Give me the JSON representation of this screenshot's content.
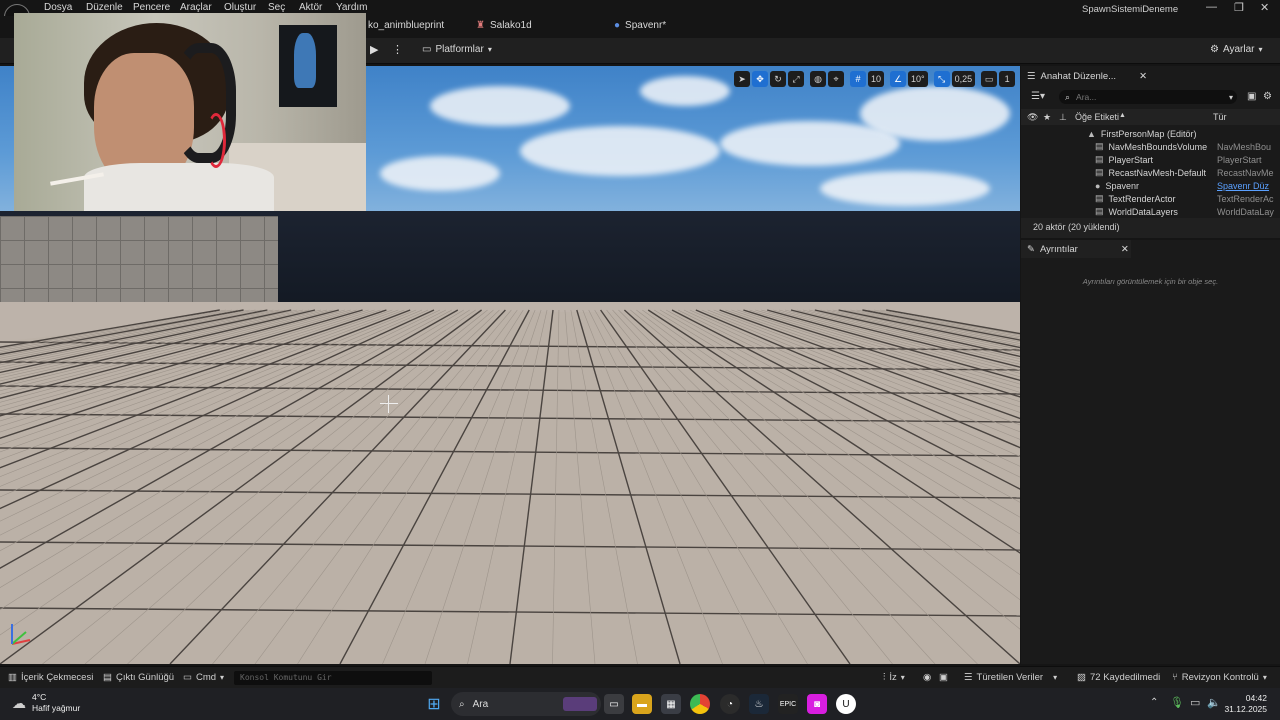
{
  "menu": {
    "items": [
      "Dosya",
      "Düzenle",
      "Pencere",
      "Araçlar",
      "Oluştur",
      "Seç",
      "Aktör",
      "Yardım"
    ],
    "project_title": "SpawnSistemiDeneme"
  },
  "tabs": [
    "ko_animblueprint",
    "Salako1d",
    "Spavenr*"
  ],
  "toolbar": {
    "platforms_label": "Platformlar",
    "settings_label": "Ayarlar"
  },
  "viewport_toolbar": {
    "grid_value": "10",
    "angle_value": "10°",
    "scale_value": "0,25",
    "camera_value": "1"
  },
  "outliner": {
    "tab_label": "Anahat Düzenle...",
    "search_placeholder": "Ara...",
    "col_label": "Öğe Etiketi",
    "col_type": "Tür",
    "rows": [
      {
        "name": "FirstPersonMap (Editör)",
        "type": ""
      },
      {
        "name": "NavMeshBoundsVolume",
        "type": "NavMeshBou"
      },
      {
        "name": "PlayerStart",
        "type": "PlayerStart"
      },
      {
        "name": "RecastNavMesh-Default",
        "type": "RecastNavMe"
      },
      {
        "name": "Spavenr",
        "type": "Spavenr Düz"
      },
      {
        "name": "TextRenderActor",
        "type": "TextRenderAc"
      },
      {
        "name": "WorldDataLayers",
        "type": "WorldDataLay"
      }
    ],
    "footer": "20 aktör (20 yüklendi)"
  },
  "details": {
    "tab_label": "Ayrıntılar",
    "empty_text": "Ayrıntıları görüntülemek için bir obje seç."
  },
  "statusbar": {
    "content_drawer": "İçerik Çekmecesi",
    "output_log": "Çıktı Günlüğü",
    "cmd": "Cmd",
    "console_placeholder": "Konsol Komutunu Gir",
    "trace": "İz",
    "derived_data": "Türetilen Veriler",
    "unsaved": "72 Kaydedilmedi",
    "revision": "Revizyon Kontrolü"
  },
  "taskbar": {
    "weather_temp": "4°C",
    "weather_desc": "Hafif yağmur",
    "search_label": "Ara",
    "time": "04:42",
    "date": "31.12.2025"
  }
}
